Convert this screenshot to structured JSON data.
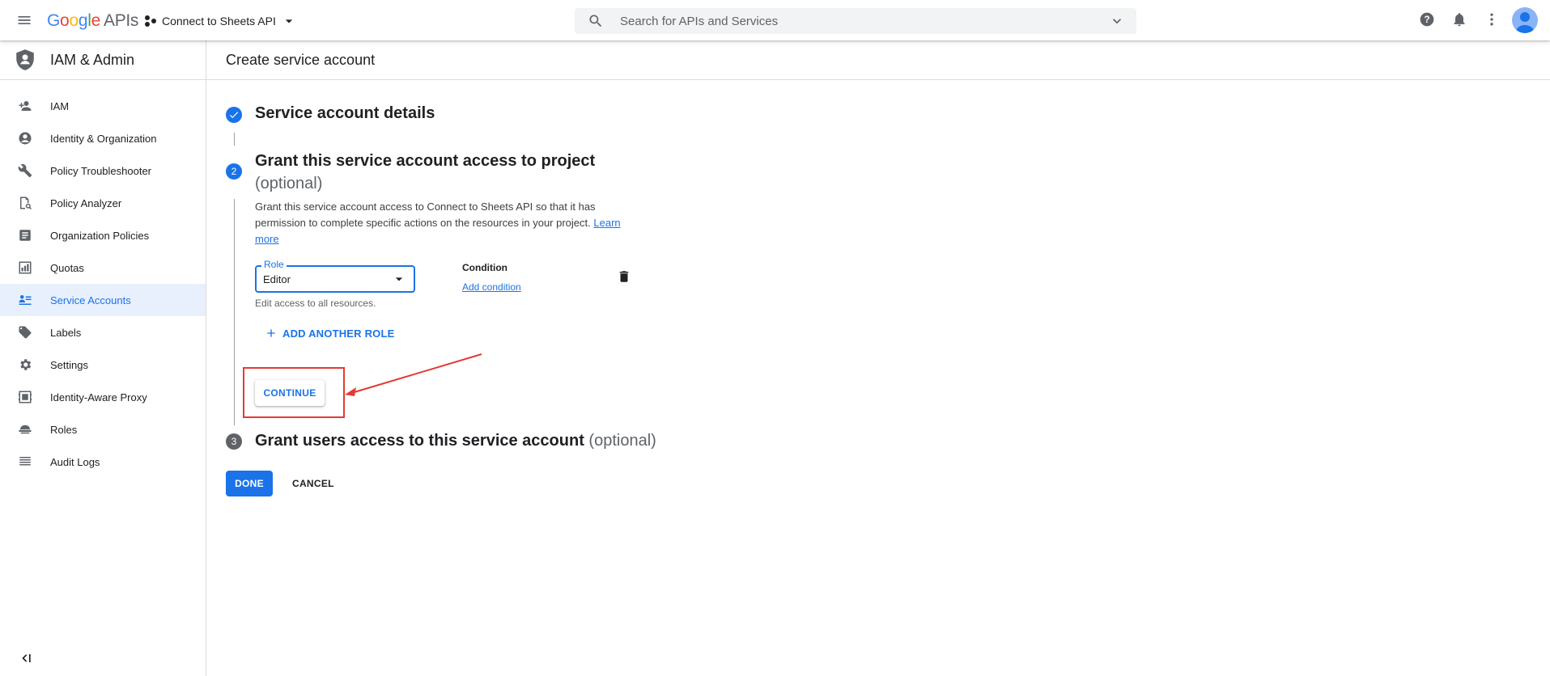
{
  "topbar": {
    "logo_google": [
      "G",
      "o",
      "o",
      "g",
      "l",
      "e"
    ],
    "logo_suffix": "APIs",
    "project_name": "Connect to Sheets API",
    "search_placeholder": "Search for APIs and Services"
  },
  "sidebar": {
    "title": "IAM & Admin",
    "items": [
      {
        "label": "IAM",
        "icon": "person-add-icon"
      },
      {
        "label": "Identity & Organization",
        "icon": "account-circle-icon"
      },
      {
        "label": "Policy Troubleshooter",
        "icon": "wrench-icon"
      },
      {
        "label": "Policy Analyzer",
        "icon": "document-search-icon"
      },
      {
        "label": "Organization Policies",
        "icon": "document-icon"
      },
      {
        "label": "Quotas",
        "icon": "quota-icon"
      },
      {
        "label": "Service Accounts",
        "icon": "service-account-icon",
        "active": true
      },
      {
        "label": "Labels",
        "icon": "tag-icon"
      },
      {
        "label": "Settings",
        "icon": "gear-icon"
      },
      {
        "label": "Identity-Aware Proxy",
        "icon": "proxy-icon"
      },
      {
        "label": "Roles",
        "icon": "roles-icon"
      },
      {
        "label": "Audit Logs",
        "icon": "list-icon"
      }
    ]
  },
  "main": {
    "page_title": "Create service account",
    "steps": [
      {
        "number": "",
        "title": "Service account details",
        "optional": "",
        "status": "complete"
      },
      {
        "number": "2",
        "title": "Grant this service account access to project",
        "optional": "(optional)",
        "status": "active"
      },
      {
        "number": "3",
        "title": "Grant users access to this service account",
        "optional": "(optional)",
        "status": "pending"
      }
    ],
    "description": "Grant this service account access to Connect to Sheets API so that it has permission to complete specific actions on the resources in your project.",
    "learn_more": "Learn more",
    "role_label": "Role",
    "role_value": "Editor",
    "role_hint": "Edit access to all resources.",
    "condition_title": "Condition",
    "add_condition": "Add condition",
    "add_another_role": "ADD ANOTHER ROLE",
    "continue_label": "CONTINUE",
    "done_label": "DONE",
    "cancel_label": "CANCEL"
  },
  "colors": {
    "accent": "#1a73e8",
    "annotation_red": "#e53935",
    "sidebar_active_bg": "#e8f0fe"
  }
}
